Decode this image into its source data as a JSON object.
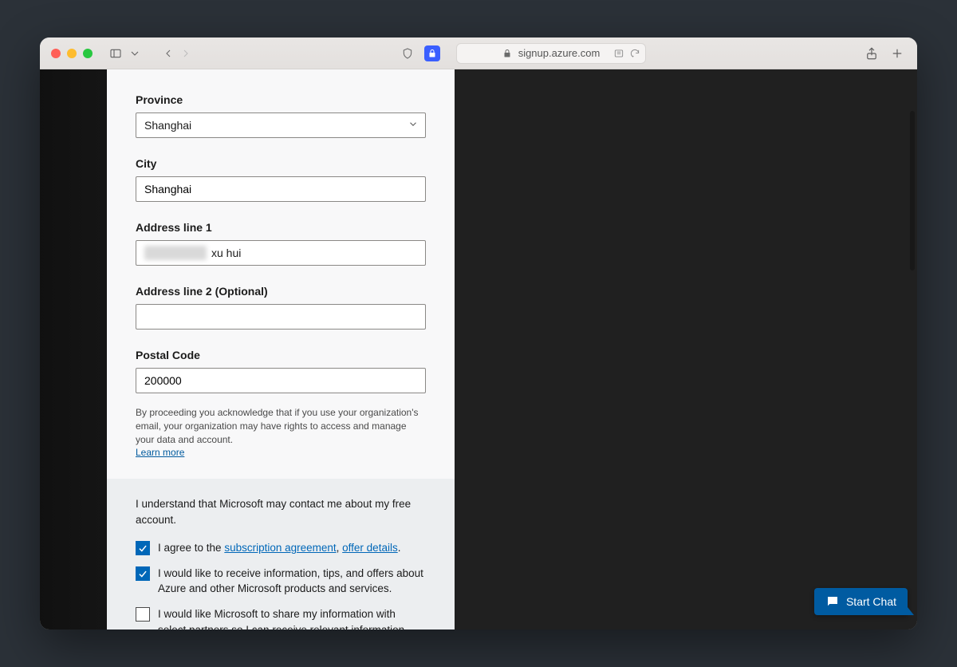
{
  "browser": {
    "url": "signup.azure.com"
  },
  "form": {
    "province": {
      "label": "Province",
      "value": "Shanghai"
    },
    "city": {
      "label": "City",
      "value": "Shanghai"
    },
    "address1": {
      "label": "Address line 1",
      "suffix": "xu hui"
    },
    "address2": {
      "label": "Address line 2 (Optional)",
      "value": ""
    },
    "postal": {
      "label": "Postal Code",
      "value": "200000"
    },
    "disclaimer": "By proceeding you acknowledge that if you use your organization's email, your organization may have rights to access and manage your data and account.",
    "learn_more": "Learn more"
  },
  "consent": {
    "intro": "I understand that Microsoft may contact me about my free account.",
    "agree_prefix": "I agree to the ",
    "subscription_link": "subscription agreement",
    "comma": ", ",
    "offer_link": "offer details",
    "period": ".",
    "info_opt_in": "I would like to receive information, tips, and offers about Azure and other Microsoft products and services.",
    "partner_share": "I would like Microsoft to share my information with select partners so I can receive relevant information about their products and services."
  },
  "chat": {
    "label": "Start Chat"
  },
  "checks": {
    "agree": true,
    "info": true,
    "partner": false
  }
}
